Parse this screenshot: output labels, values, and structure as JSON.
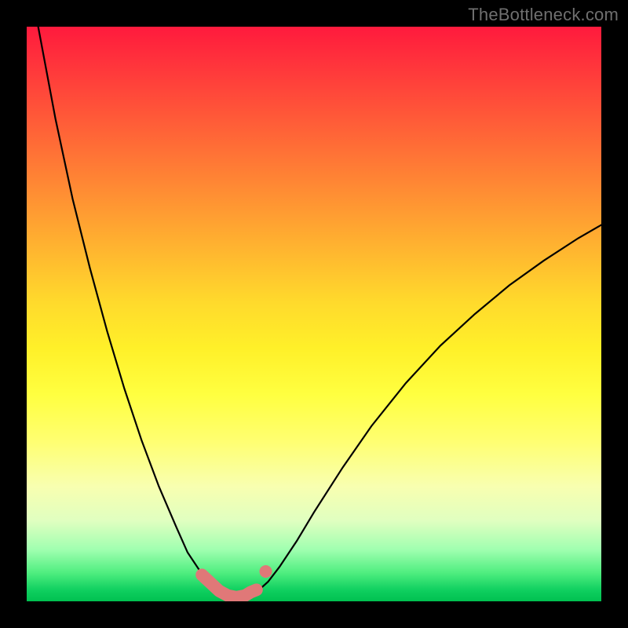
{
  "watermark": {
    "text": "TheBottleneck.com"
  },
  "chart_data": {
    "type": "line",
    "title": "",
    "xlabel": "",
    "ylabel": "",
    "xlim": [
      0,
      100
    ],
    "ylim": [
      0,
      100
    ],
    "series": [
      {
        "name": "curve",
        "x": [
          2,
          5,
          8,
          11,
          14,
          17,
          20,
          23,
          26,
          28,
          30,
          32,
          34,
          35.5,
          37,
          38.5,
          40,
          42,
          44,
          47,
          50,
          55,
          60,
          66,
          72,
          78,
          84,
          90,
          96,
          100
        ],
        "y": [
          100,
          84,
          70,
          58,
          47,
          37,
          28,
          20,
          13,
          8.5,
          5.5,
          3.3,
          1.8,
          1.0,
          0.6,
          0.9,
          1.6,
          3.4,
          6.0,
          10.5,
          15.5,
          23.3,
          30.5,
          38.0,
          44.5,
          50.0,
          55.0,
          59.3,
          63.2,
          65.5
        ]
      }
    ],
    "highlight": {
      "name": "optimal-band",
      "color": "#e07878",
      "x": [
        30.5,
        32,
        33.5,
        35,
        36.5,
        38,
        39,
        40
      ],
      "y": [
        4.6,
        3.2,
        1.8,
        1.0,
        0.7,
        1.0,
        1.6,
        2.0
      ]
    },
    "background_gradient": {
      "top": "#ff1a3d",
      "mid": "#fff029",
      "bottom": "#00c050"
    }
  }
}
